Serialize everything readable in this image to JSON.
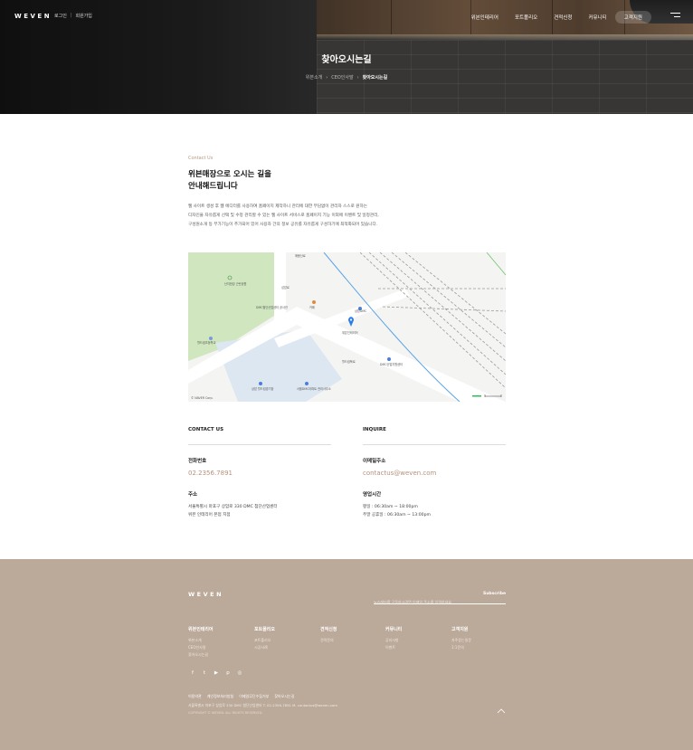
{
  "header": {
    "logo": "WEVEN",
    "top_links": [
      "로그인",
      "회원가입"
    ],
    "nav": [
      "위븐인테리어",
      "포트폴리오",
      "견적신청",
      "커뮤니티",
      "고객지원"
    ],
    "active_nav": "고객지원",
    "menu_icon": "hamburger-icon"
  },
  "hero": {
    "title": "찾아오시는길",
    "breadcrumb": [
      "위븐소개",
      "CEO인사말",
      "찾아오시는길"
    ]
  },
  "intro": {
    "eyebrow": "Contact Us",
    "headline_line1": "위븐매장으로 오시는 길을",
    "headline_line2": "안내해드립니다",
    "desc_line1": "웹 사이트 생성 후 웹 에디터를 사용하여 홈페이지 제작하니 관리에 대한 부담없이 관리자 스스로 원하는",
    "desc_line2": "디자인을 자유롭게 선택 및 수정 관리할 수 있는 웹 사이트 서비스로 홈페이지 기능 이외에 이벤트 및 일정관리,",
    "desc_line3": "구성원소개 등 부가기능이 추가되어 있어 사용자 간의 정보 공유를 자유롭게 구성하기에 최적화되어 있습니다."
  },
  "map": {
    "labels": {
      "park": "난지한강 근린공원",
      "school": "월드컵초등학교",
      "building1": "DMC첨단산업센터 공사관",
      "cafe": "카페",
      "station": "상암DMC",
      "company": "위븐인테리어",
      "office": "DMC산업지원센터",
      "apt": "서울DMC아파트 관리사무소",
      "hall": "상암 월드컵경기장",
      "road1": "매봉산로",
      "road2": "성암로",
      "road3": "월드컵북로",
      "copyright": "© NAVER Corp."
    }
  },
  "contact": {
    "col1_title": "CONTACT US",
    "col2_title": "INQUIRE",
    "phone_label": "전화번호",
    "phone": "02.2356.7891",
    "address_label": "주소",
    "address_line1": "서울특별시 마포구 상암로 330 DMC 첨단산업센터",
    "address_line2": "위븐 인테리어 본점 지점",
    "email_label": "이메일주소",
    "email": "contactus@weven.com",
    "hours_label": "영업시간",
    "hours_line1": "평일 : 06:30am ~ 18:00pm",
    "hours_line2": "주말 공휴일 : 06:30am ~ 13:00pm"
  },
  "footer": {
    "logo": "WEVEN",
    "subscribe_placeholder": "뉴스레터를 구독하시려면 이메일 주소를 입력하세요",
    "subscribe_button": "Subscribe",
    "menus": [
      {
        "title": "위븐인테리어",
        "items": [
          "위븐소개",
          "CEO인사말",
          "찾아오시는길"
        ]
      },
      {
        "title": "포트폴리오",
        "items": [
          "포트폴리오",
          "시공사례"
        ]
      },
      {
        "title": "견적신청",
        "items": [
          "견적문의"
        ]
      },
      {
        "title": "커뮤니티",
        "items": [
          "공지사항",
          "이벤트"
        ]
      },
      {
        "title": "고객지원",
        "items": [
          "자주묻는질문",
          "1:1문의"
        ]
      }
    ],
    "social_icons": [
      "facebook-icon",
      "twitter-icon",
      "youtube-icon",
      "pinterest-icon",
      "instagram-icon"
    ],
    "links": [
      "이용약관",
      "개인정보처리방침",
      "이메일무단수집거부",
      "찾아오시는길"
    ],
    "address": "서울특별시 마포구 상암로 330 DMC 첨단산업센터  T. 02-2356-7891  M. contactus@weven.com",
    "copyright": "COPYRIGHT © WEVEN. ALL RIGHTS RESERVED.",
    "to_top_icon": "chevron-up-icon"
  },
  "colors": {
    "accent": "#b8917a",
    "footer_bg": "#bba999"
  }
}
